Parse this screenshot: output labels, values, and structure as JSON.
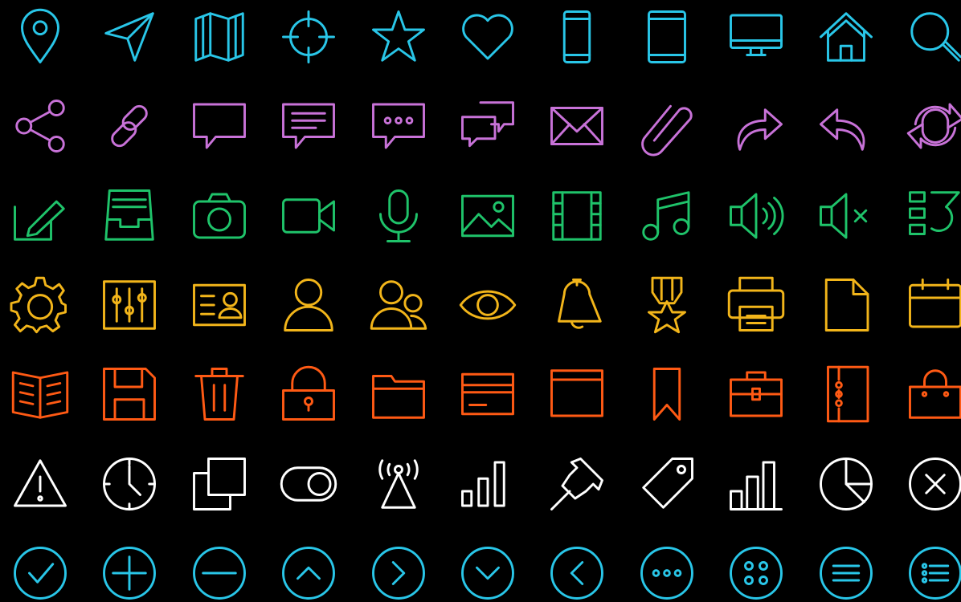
{
  "colors": {
    "background": "#000000",
    "row_1": "#29c6e8",
    "row_2": "#c872d8",
    "row_3": "#1fc36a",
    "row_4": "#f2b51a",
    "row_5": "#ff5a14",
    "row_6": "#ffffff",
    "row_7": "#29c6e8"
  },
  "rows": [
    [
      "location-pin-icon",
      "send-icon",
      "map-icon",
      "crosshair-icon",
      "star-icon",
      "heart-icon",
      "smartphone-icon",
      "tablet-icon",
      "monitor-icon",
      "home-icon",
      "search-icon"
    ],
    [
      "share-icon",
      "link-icon",
      "speech-bubble-icon",
      "text-message-icon",
      "typing-message-icon",
      "conversation-icon",
      "envelope-icon",
      "paperclip-icon",
      "forward-arrow-icon",
      "reply-arrow-icon",
      "refresh-icon"
    ],
    [
      "edit-icon",
      "inbox-tray-icon",
      "camera-icon",
      "video-camera-icon",
      "microphone-icon",
      "image-icon",
      "film-strip-icon",
      "music-note-icon",
      "volume-on-icon",
      "volume-mute-icon",
      "playlist-icon"
    ],
    [
      "gear-icon",
      "mixer-sliders-icon",
      "id-card-icon",
      "user-icon",
      "users-icon",
      "eye-icon",
      "bell-icon",
      "medal-icon",
      "printer-icon",
      "document-icon",
      "calendar-icon"
    ],
    [
      "open-book-icon",
      "floppy-disk-icon",
      "trash-can-icon",
      "lock-icon",
      "folder-icon",
      "credit-card-icon",
      "browser-window-icon",
      "bookmark-icon",
      "briefcase-icon",
      "notebook-icon",
      "shopping-bag-icon"
    ],
    [
      "warning-icon",
      "clock-icon",
      "duplicate-icon",
      "toggle-switch-icon",
      "broadcast-tower-icon",
      "signal-bars-icon",
      "push-pin-icon",
      "price-tag-icon",
      "bar-chart-icon",
      "pie-chart-icon",
      "close-circle-icon"
    ],
    [
      "check-circle-icon",
      "plus-circle-icon",
      "minus-circle-icon",
      "chevron-up-circle-icon",
      "chevron-right-circle-icon",
      "chevron-down-circle-icon",
      "chevron-left-circle-icon",
      "more-horizontal-circle-icon",
      "grid-dots-circle-icon",
      "menu-circle-icon",
      "list-circle-icon"
    ]
  ]
}
